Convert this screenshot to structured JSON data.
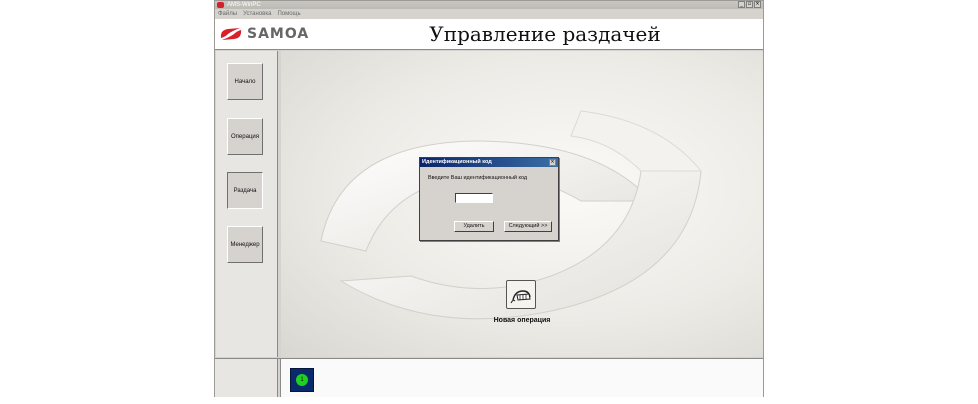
{
  "window": {
    "title": "AMS-WinPC",
    "controls": {
      "minimize": "_",
      "maximize": "▫",
      "close": "×"
    }
  },
  "menu": {
    "items": [
      "Файлы",
      "Установка",
      "Помощь"
    ]
  },
  "header": {
    "logo_text": "SAMOA",
    "title": "Управление раздачей"
  },
  "sidebar": {
    "items": [
      "Начало",
      "Операция",
      "Раздача",
      "Менеджер"
    ],
    "active": "Раздача"
  },
  "dialog": {
    "title": "Идентификационный код",
    "label": "Введите Ваш идентификационный код",
    "input": {
      "value": "",
      "placeholder": ""
    },
    "delete_button": "Удалить",
    "next_button": "Следующий >>",
    "close": "×"
  },
  "main": {
    "new_operation_label": "Новая операция"
  },
  "status": {
    "indicator": "1",
    "color": "#1ed11e"
  },
  "colors": {
    "brand_red": "#d8202a",
    "dialog_title": "#0a246a",
    "status_panel": "#0b2a6b"
  },
  "icons": [
    "samoa-logo-icon",
    "new-operation-icon",
    "status-indicator-icon"
  ]
}
